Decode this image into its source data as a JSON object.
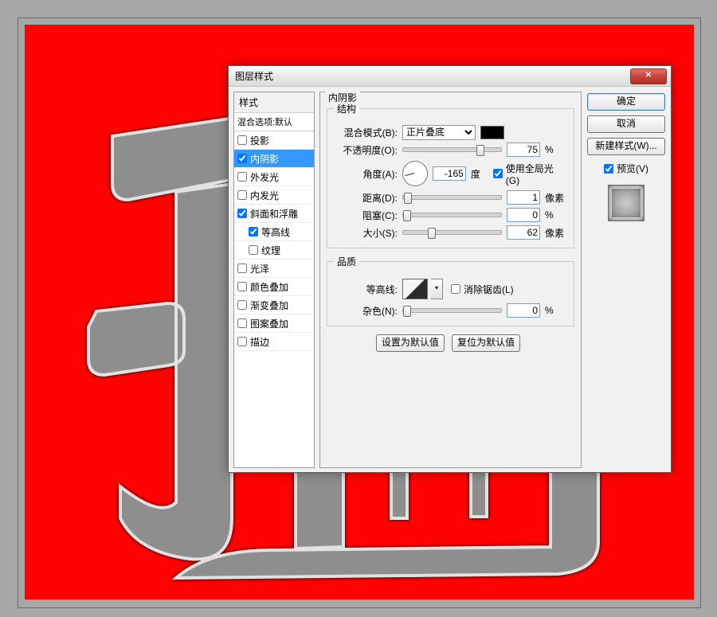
{
  "dialog": {
    "title": "图层样式",
    "section_label": "内阴影",
    "close_glyph": "✕"
  },
  "styles_panel": {
    "header": "样式",
    "blend_options": "混合选项:默认",
    "items": [
      {
        "key": "drop_shadow",
        "label": "投影",
        "checked": false,
        "selected": false
      },
      {
        "key": "inner_shadow",
        "label": "内阴影",
        "checked": true,
        "selected": true
      },
      {
        "key": "outer_glow",
        "label": "外发光",
        "checked": false,
        "selected": false
      },
      {
        "key": "inner_glow",
        "label": "内发光",
        "checked": false,
        "selected": false
      },
      {
        "key": "bevel_emboss",
        "label": "斜面和浮雕",
        "checked": true,
        "selected": false
      },
      {
        "key": "contour",
        "label": "等高线",
        "checked": true,
        "selected": false,
        "sub": true
      },
      {
        "key": "texture",
        "label": "纹理",
        "checked": false,
        "selected": false,
        "sub": true
      },
      {
        "key": "satin",
        "label": "光泽",
        "checked": false,
        "selected": false
      },
      {
        "key": "color_overlay",
        "label": "颜色叠加",
        "checked": false,
        "selected": false
      },
      {
        "key": "grad_overlay",
        "label": "渐变叠加",
        "checked": false,
        "selected": false
      },
      {
        "key": "pat_overlay",
        "label": "图案叠加",
        "checked": false,
        "selected": false
      },
      {
        "key": "stroke",
        "label": "描边",
        "checked": false,
        "selected": false
      }
    ]
  },
  "structure": {
    "legend": "结构",
    "blend_mode_label": "混合模式(B):",
    "blend_mode_value": "正片叠底",
    "color": "#000000",
    "opacity_label": "不透明度(O):",
    "opacity_value": "75",
    "opacity_unit": "%",
    "angle_label": "角度(A):",
    "angle_value": "-165",
    "angle_unit": "度",
    "use_global_label": "使用全局光(G)",
    "use_global_checked": true,
    "distance_label": "距离(D):",
    "distance_value": "1",
    "distance_unit": "像素",
    "choke_label": "阻塞(C):",
    "choke_value": "0",
    "choke_unit": "%",
    "size_label": "大小(S):",
    "size_value": "62",
    "size_unit": "像素"
  },
  "quality": {
    "legend": "品质",
    "contour_label": "等高线:",
    "antialias_label": "消除锯齿(L)",
    "antialias_checked": false,
    "noise_label": "杂色(N):",
    "noise_value": "0",
    "noise_unit": "%"
  },
  "defaults": {
    "make_default": "设置为默认值",
    "reset_default": "复位为默认值"
  },
  "buttons": {
    "ok": "确定",
    "cancel": "取消",
    "new_style": "新建样式(W)...",
    "preview": "预览(V)",
    "preview_checked": true
  }
}
